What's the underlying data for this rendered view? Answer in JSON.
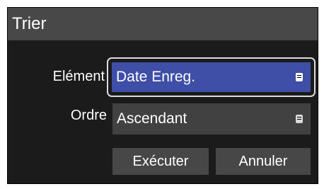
{
  "dialog": {
    "title": "Trier",
    "fields": {
      "element_label": "Elément",
      "element_value": "Date Enreg.",
      "order_label": "Ordre",
      "order_value": "Ascendant"
    },
    "buttons": {
      "execute_label": "Exécuter",
      "cancel_label": "Annuler"
    },
    "icons": {
      "dropdown": "menu-list-icon"
    },
    "colors": {
      "focus_select": "#3f4ea6",
      "title_bar": "#484848",
      "dialog_bg": "#1b1b1b"
    }
  }
}
